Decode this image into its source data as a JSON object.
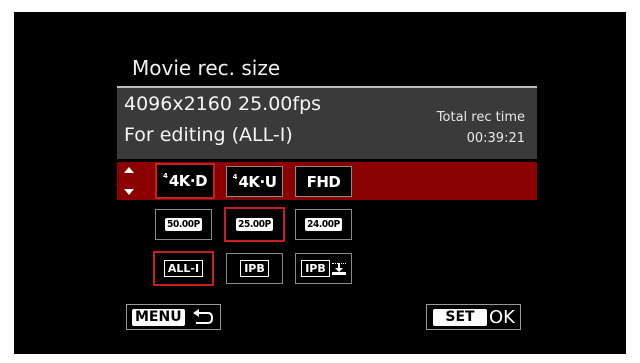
{
  "header": {
    "title": "Movie rec. size"
  },
  "info": {
    "resolution": "4096x2160 25.00fps",
    "mode": "For editing (ALL-I)",
    "total_rec_time_label": "Total rec time",
    "total_rec_time_value": "00:39:21"
  },
  "size_options": [
    {
      "prefix": "4",
      "label": "4K·D",
      "selected": true
    },
    {
      "prefix": "4",
      "label": "4K·U",
      "selected": false
    },
    {
      "prefix": "",
      "label": "FHD",
      "selected": false
    }
  ],
  "fps_options": [
    {
      "label": "50.00P",
      "selected": false
    },
    {
      "label": "25.00P",
      "selected": true
    },
    {
      "label": "24.00P",
      "selected": false
    }
  ],
  "compression_options": [
    {
      "label": "ALL-I",
      "selected": true
    },
    {
      "label": "IPB",
      "selected": false
    },
    {
      "label": "IPB",
      "selected": false,
      "icon": "light-download-icon"
    }
  ],
  "footer": {
    "menu_label": "MENU",
    "menu_icon": "return-arrow-icon",
    "set_label": "SET",
    "ok_label": "OK"
  },
  "colors": {
    "background": "#000000",
    "highlight_row": "#8b0000",
    "selected_border": "#c42020",
    "info_panel": "#3a3a3a"
  }
}
